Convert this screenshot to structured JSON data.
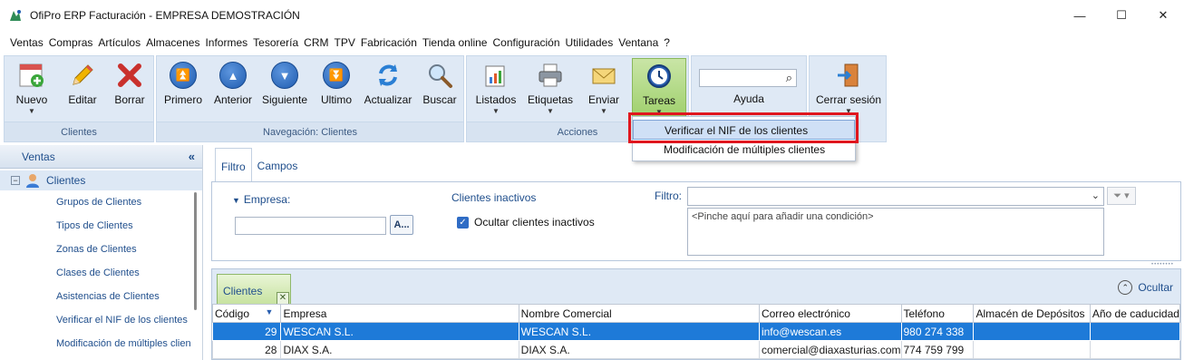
{
  "window": {
    "title": "OfiPro ERP Facturación - EMPRESA DEMOSTRACIÓN",
    "minimize": "—",
    "maximize": "☐",
    "close": "✕"
  },
  "menu": [
    "Ventas",
    "Compras",
    "Artículos",
    "Almacenes",
    "Informes",
    "Tesorería",
    "CRM",
    "TPV",
    "Fabricación",
    "Tienda online",
    "Configuración",
    "Utilidades",
    "Ventana",
    "?"
  ],
  "ribbon": {
    "clientes": {
      "caption": "Clientes",
      "nuevo": "Nuevo",
      "editar": "Editar",
      "borrar": "Borrar"
    },
    "navegacion": {
      "caption": "Navegación: Clientes",
      "primero": "Primero",
      "anterior": "Anterior",
      "siguiente": "Siguiente",
      "ultimo": "Ultimo",
      "actualizar": "Actualizar",
      "buscar": "Buscar"
    },
    "acciones": {
      "caption": "Acciones",
      "listados": "Listados",
      "etiquetas": "Etiquetas",
      "enviar": "Enviar",
      "tareas": "Tareas"
    },
    "ayuda": {
      "label": "Ayuda",
      "search_value": ""
    },
    "sesion": {
      "cerrar": "Cerrar sesión"
    }
  },
  "tareas_menu": {
    "items": [
      "Verificar el NIF de los clientes",
      "Modificación de múltiples clientes"
    ]
  },
  "sidebar": {
    "header": "Ventas",
    "collapse": "«",
    "root": "Clientes",
    "expander": "−",
    "items": [
      "Grupos de Clientes",
      "Tipos de Clientes",
      "Zonas de Clientes",
      "Clases de Clientes",
      "Asistencias de Clientes",
      "Verificar el NIF de los clientes",
      "Modificación de múltiples clientes"
    ]
  },
  "filter": {
    "tabs": [
      "Filtro",
      "Campos"
    ],
    "empresa_label": "Empresa:",
    "empresa_value": "",
    "empresa_btn": "A...",
    "inactivos_label": "Clientes inactivos",
    "ocultar_inactivos": "Ocultar clientes inactivos",
    "filtro_label": "Filtro:",
    "filtro_value": "",
    "condition_hint": "<Pinche aquí para añadir una condición>"
  },
  "grid": {
    "tab_label": "Clientes",
    "ocultar": "Ocultar",
    "columns": [
      "Código",
      "Empresa",
      "Nombre Comercial",
      "Correo electrónico",
      "Teléfono",
      "Almacén de Depósitos",
      "Año de caducidad"
    ],
    "rows": [
      [
        "29",
        "WESCAN S.L.",
        "WESCAN S.L.",
        "info@wescan.es",
        "980 274 338",
        "",
        ""
      ],
      [
        "28",
        "DIAX S.A.",
        "DIAX S.A.",
        "comercial@diaxasturias.com",
        "774 759 799",
        "",
        ""
      ]
    ],
    "selected_row": 0
  },
  "colors": {
    "ribbon_bg": "#dfe9f5",
    "accent_blue": "#1f4e8c",
    "selection": "#1e7ad8",
    "highlight_red": "#e0161e",
    "tareas_green": "#9dcf6a"
  }
}
